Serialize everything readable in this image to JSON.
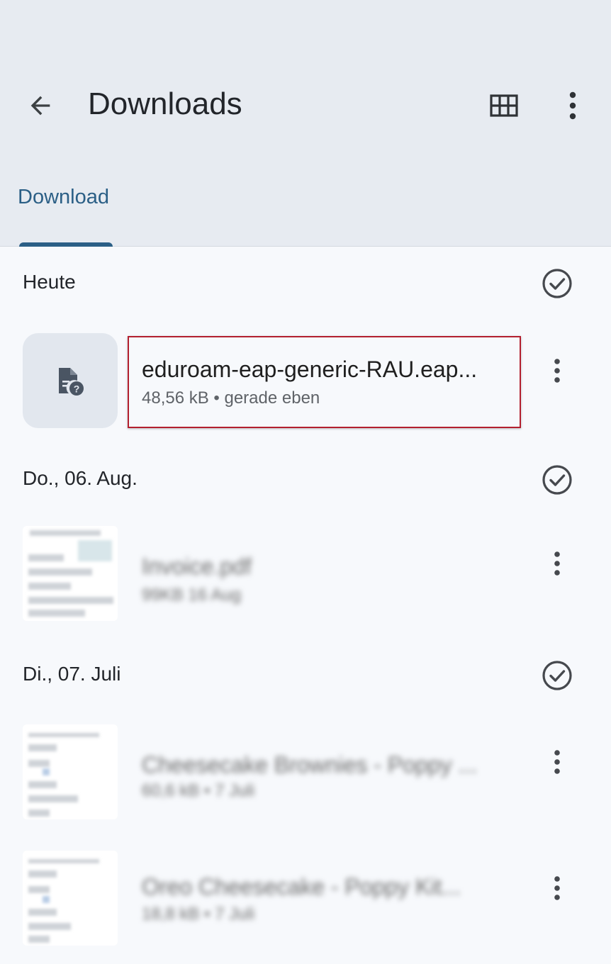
{
  "header": {
    "title": "Downloads",
    "back_icon": "arrow-back-icon",
    "grid_icon": "grid-view-icon",
    "more_icon": "more-vert-icon"
  },
  "tabs": [
    {
      "label": "Download",
      "selected": true
    }
  ],
  "sections": [
    {
      "label": "Heute",
      "items": [
        {
          "name": "eduroam-eap-generic-RAU.eap...",
          "meta": "48,56 kB • gerade eben",
          "icon": "unknown-file-icon",
          "highlighted": true
        }
      ]
    },
    {
      "label": "Do., 06. Aug.",
      "items": [
        {
          "name": "Invoice.pdf",
          "meta": "99KB 16 Aug",
          "icon": "pdf-thumbnail",
          "blurred": true
        }
      ]
    },
    {
      "label": "Di., 07. Juli",
      "items": [
        {
          "name": "Cheesecake Brownies - Poppy ...",
          "meta": "60,6 kB • 7 Juli",
          "icon": "pdf-thumbnail",
          "blurred": true
        },
        {
          "name": "Oreo Cheesecake - Poppy Kit...",
          "meta": "18,8 kB • 7 Juli",
          "icon": "pdf-thumbnail",
          "blurred": true
        }
      ]
    }
  ],
  "colors": {
    "accent": "#2b5f86",
    "appbar": "#e7ebf1",
    "background": "#f7f9fc",
    "highlight": "#b3202f"
  }
}
